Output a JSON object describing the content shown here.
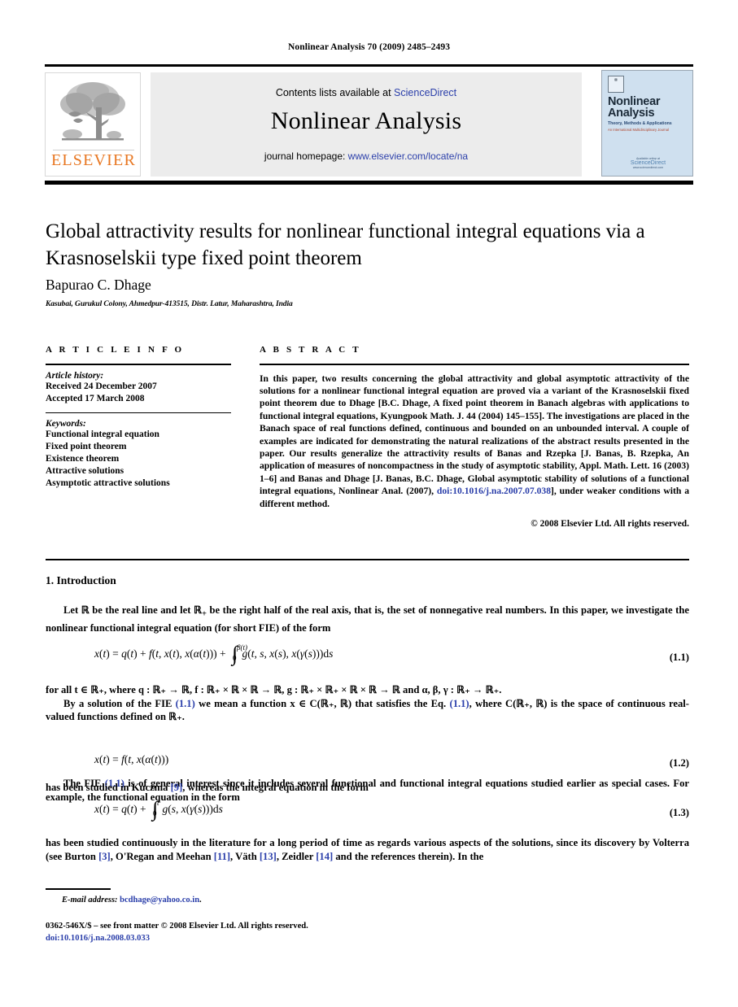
{
  "running_head": "Nonlinear Analysis 70 (2009) 2485–2493",
  "masthead": {
    "publisher": "ELSEVIER",
    "contents_prefix": "Contents lists available at ",
    "contents_link": "ScienceDirect",
    "journal_name": "Nonlinear Analysis",
    "homepage_prefix": "journal homepage: ",
    "homepage_url": "www.elsevier.com/locate/na",
    "cover": {
      "logo_text": "ELSEVIER",
      "title": "Nonlinear Analysis",
      "subtitle": "Theory, Methods & Applications",
      "subtitle2": "An International Multidisciplinary Journal",
      "footer_small": "Available online at",
      "footer_brand": "ScienceDirect",
      "footer_tiny": "www.sciencedirect.com"
    }
  },
  "article": {
    "title": "Global attractivity results for nonlinear functional integral equations via a Krasnoselskii type fixed point theorem",
    "author": "Bapurao C. Dhage",
    "affiliation": "Kasubai, Gurukul Colony, Ahmedpur-413515, Distr. Latur, Maharashtra, India"
  },
  "info": {
    "heading": "A R T I C L E   I N F O",
    "history_label": "Article history:",
    "received": "Received 24 December 2007",
    "accepted": "Accepted 17 March 2008",
    "keywords_label": "Keywords:",
    "keywords": [
      "Functional integral equation",
      "Fixed point theorem",
      "Existence theorem",
      "Attractive solutions",
      "Asymptotic attractive solutions"
    ]
  },
  "abstract": {
    "heading": "A B S T R A C T",
    "part1": "In this paper, two results concerning the global attractivity and global asymptotic attractivity of the solutions for a nonlinear functional integral equation are proved via a variant of the Krasnoselskii fixed point theorem due to Dhage [B.C. Dhage, A fixed point theorem in Banach algebras with applications to functional integral equations, Kyungpook Math. J. 44 (2004) 145–155]. The investigations are placed in the Banach space of real functions defined, continuous and bounded on an unbounded interval. A couple of examples are indicated for demonstrating the natural realizations of the abstract results presented in the paper. Our results generalize the attractivity results of Banas and Rzepka [J. Banas, B. Rzepka, An application of measures of noncompactness in the study of asymptotic stability, Appl. Math. Lett. 16 (2003) 1–6] and Banas and Dhage [J. Banas, B.C. Dhage, Global asymptotic stability of solutions of a functional integral equations, Nonlinear Anal. (2007), ",
    "doi_link": "doi:10.1016/j.na.2007.07.038",
    "part2": "], under weaker conditions with a different method.",
    "copyright": "© 2008 Elsevier Ltd. All rights reserved."
  },
  "body": {
    "section_heading": "1. Introduction",
    "para1_a": "Let ℝ be the real line and let ℝ",
    "para1_b": " be the right half of the real axis, that is, the set of nonnegative real numbers. In this paper, we investigate the nonlinear functional integral equation (for short FIE) of the form",
    "eq1_num": "(1.1)",
    "para2_line1": "for all t ∈ ℝ₊, where q : ℝ₊ → ℝ, f : ℝ₊ × ℝ × ℝ → ℝ, g : ℝ₊ × ℝ₊ × ℝ × ℝ → ℝ and α, β, γ : ℝ₊ → ℝ₊.",
    "para2_a": "By a solution of the FIE ",
    "para2_ref1": "(1.1)",
    "para2_b": " we mean a function x ∈ C(ℝ₊, ℝ) that satisfies the Eq. ",
    "para2_ref2": "(1.1)",
    "para2_c": ", where C(ℝ₊, ℝ) is the space of continuous real-valued functions defined on ℝ₊.",
    "para3_a": "The FIE ",
    "para3_ref": "(1.1)",
    "para3_b": " is of general interest since it includes several functional and functional integral equations studied earlier as special cases. For example, the functional equation in the form",
    "eq2_num": "(1.2)",
    "para4_a": "has been studied in Kuczma ",
    "para4_ref": "[9]",
    "para4_b": ", whereas the integral equation in the form",
    "eq3_num": "(1.3)",
    "para5_a": "has been studied continuously in the literature for a long period of time as regards various aspects of the solutions, since its discovery by Volterra (see Burton ",
    "para5_r1": "[3]",
    "para5_b": ", O'Regan and Meehan ",
    "para5_r2": "[11]",
    "para5_c": ", Väth ",
    "para5_r3": "[13]",
    "para5_d": ", Zeidler ",
    "para5_r4": "[14]",
    "para5_e": " and the references therein). In the"
  },
  "footnote": {
    "email_label": "E-mail address:",
    "email": "bcdhage@yahoo.co.in",
    "email_period": ".",
    "front_matter": "0362-546X/$ – see front matter © 2008 Elsevier Ltd. All rights reserved.",
    "doi": "doi:10.1016/j.na.2008.03.033"
  },
  "colors": {
    "link": "#2b3faa",
    "elsevier_orange": "#E87722",
    "banner_gray": "#ececec",
    "cover_blue": "#cfe0ef"
  }
}
